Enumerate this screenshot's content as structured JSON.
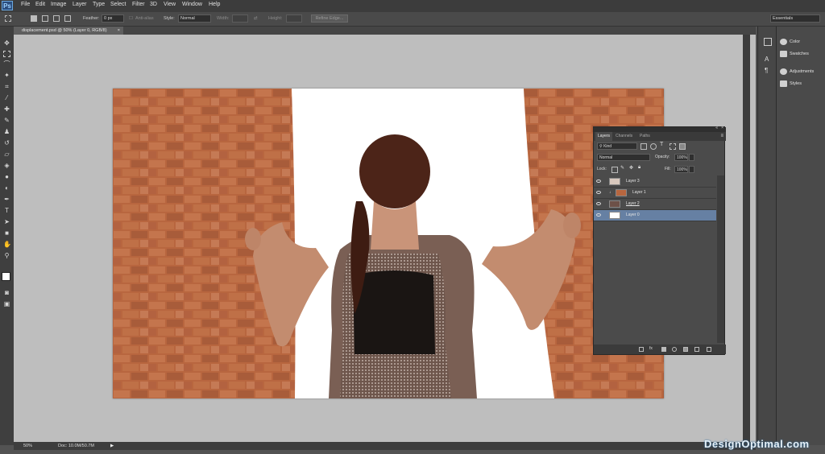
{
  "app": {
    "logo": "Ps"
  },
  "menu": [
    "File",
    "Edit",
    "Image",
    "Layer",
    "Type",
    "Select",
    "Filter",
    "3D",
    "View",
    "Window",
    "Help"
  ],
  "options": {
    "feather_label": "Feather:",
    "feather_value": "0 px",
    "anti_alias_label": "Anti-alias",
    "style_label": "Style:",
    "style_value": "Normal",
    "width_label": "Width:",
    "height_label": "Height:",
    "refine_edge_label": "Refine Edge...",
    "workspace_value": "Essentials"
  },
  "document_tab": {
    "title": "displacement.psd @ 50% (Layer 0, RGB/8)",
    "close": "×"
  },
  "status": {
    "zoom": "50%",
    "doc": "Doc: 10.0M/50.7M"
  },
  "dock": {
    "items": [
      {
        "label": "Color",
        "icon": "color-wheel-icon"
      },
      {
        "label": "Swatches",
        "icon": "swatches-grid-icon"
      },
      {
        "label": "Adjustments",
        "icon": "adjustments-icon"
      },
      {
        "label": "Styles",
        "icon": "styles-icon"
      }
    ]
  },
  "layers_panel": {
    "tabs": [
      "Layers",
      "Channels",
      "Paths"
    ],
    "active_tab": "Layers",
    "filter_value": "Kind",
    "blend_mode": "Normal",
    "opacity_label": "Opacity:",
    "opacity_value": "100%",
    "lock_label": "Lock:",
    "fill_label": "Fill:",
    "fill_value": "100%",
    "layers": [
      {
        "name": "Layer 3",
        "selected": false
      },
      {
        "name": "Layer 1",
        "selected": false
      },
      {
        "name": "Layer 2",
        "selected": false
      },
      {
        "name": "Layer 0",
        "selected": true
      }
    ],
    "footer_icons": [
      "link-icon",
      "fx-icon",
      "mask-icon",
      "adjustment-layer-icon",
      "group-folder-icon",
      "new-layer-icon",
      "trash-icon"
    ]
  },
  "watermark": "DesignOptimal.com",
  "colors": {
    "brick": "#b96a48",
    "mortar": "#d9cfc4",
    "selected_layer": "#6680a3",
    "canvas_bg": "#bebebe"
  }
}
